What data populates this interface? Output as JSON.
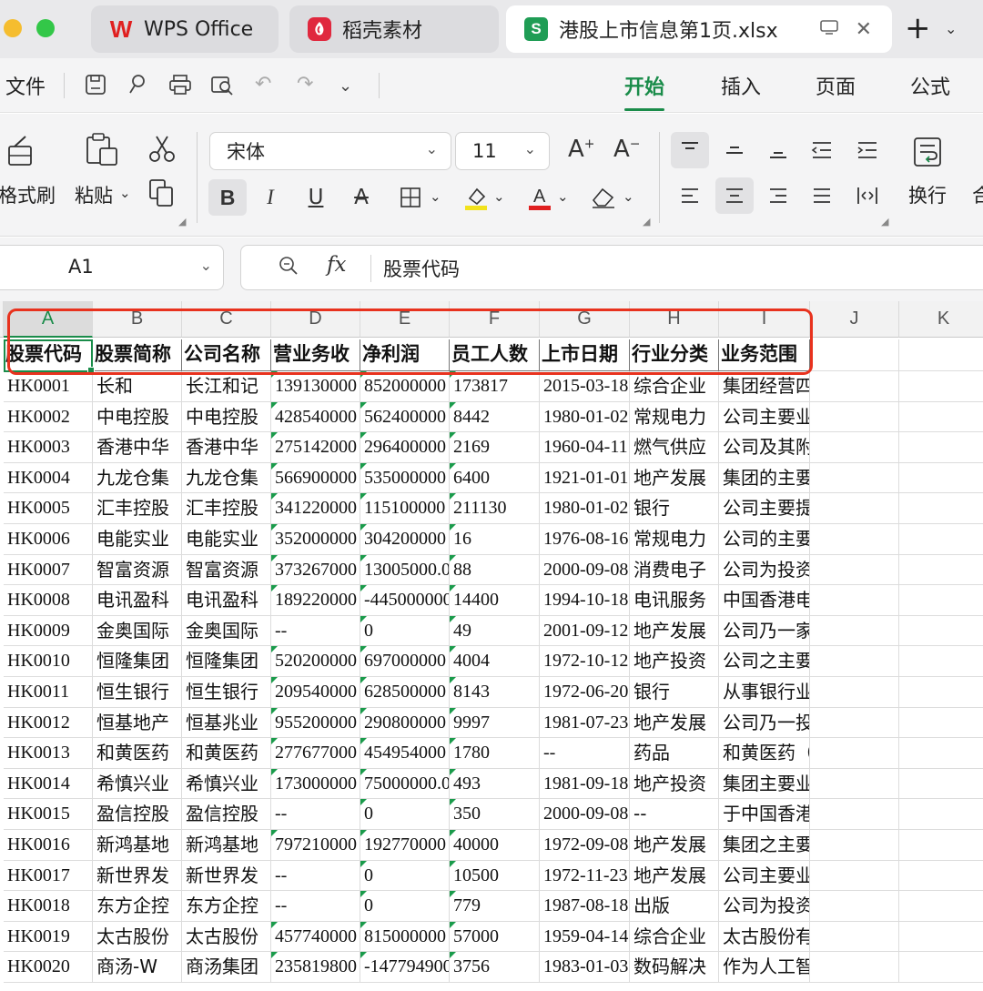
{
  "tabs": [
    {
      "label": "WPS Office",
      "icon": "wps-logo-icon"
    },
    {
      "label": "稻壳素材",
      "icon": "docer-logo-icon"
    },
    {
      "label": "港股上市信息第1页.xlsx",
      "icon": "spreadsheet-icon",
      "icon_letter": "S"
    }
  ],
  "menu": {
    "file_label": "文件",
    "ribbon_tabs": [
      "开始",
      "插入",
      "页面",
      "公式"
    ],
    "active_tab": "开始"
  },
  "ribbon": {
    "format_painter_label": "格式刷",
    "paste_label": "粘贴",
    "font_name": "宋体",
    "font_size": "11",
    "wrap_label": "换行",
    "merge_label_partial": "合"
  },
  "formula_bar": {
    "name_box": "A1",
    "fx_label": "fx",
    "value": "股票代码"
  },
  "columns": [
    "A",
    "B",
    "C",
    "D",
    "E",
    "F",
    "G",
    "H",
    "I",
    "J",
    "K"
  ],
  "selected_column": "A",
  "header_row": [
    "股票代码",
    "股票简称",
    "公司名称",
    "营业务收",
    "净利润",
    "员工人数",
    "上市日期",
    "行业分类",
    "业务范围"
  ],
  "rows": [
    [
      "HK0001",
      "长和",
      "长江和记",
      "139130000",
      "852000000",
      "173817",
      "2015-03-18",
      "综合企业",
      "集团经营四项核心业务:港口及"
    ],
    [
      "HK0002",
      "中电控股",
      "中电控股",
      "428540000",
      "562400000",
      "8442",
      "1980-01-02",
      "常规电力",
      "公司主要业务为投资控股，其"
    ],
    [
      "HK0003",
      "香港中华",
      "香港中华",
      "275142000",
      "296400000",
      "2169",
      "1960-04-11",
      "燃气供应",
      "公司及其附属公司（统称‘集"
    ],
    [
      "HK0004",
      "九龙仓集",
      "九龙仓集",
      "566900000",
      "535000000",
      "6400",
      "1921-01-01",
      "地产发展",
      "集团的主要业务为中国香港及"
    ],
    [
      "HK0005",
      "汇丰控股",
      "汇丰控股",
      "341220000",
      "115100000",
      "211130",
      "1980-01-02",
      "银行",
      "公司主要提供零售银行及财富"
    ],
    [
      "HK0006",
      "电能实业",
      "电能实业",
      "352000000",
      "304200000",
      "16",
      "1976-08-16",
      "常规电力",
      "公司的主要业务为投资控股。"
    ],
    [
      "HK0007",
      "智富资源",
      "智富资源",
      "373267000",
      "13005000.0",
      "88",
      "2000-09-08",
      "消费电子",
      "公司为投资控股公司。公司及"
    ],
    [
      "HK0008",
      "电讯盈科",
      "电讯盈科",
      "189220000",
      "-445000000",
      "14400",
      "1994-10-18",
      "电讯服务",
      "中国香港电讯及其附属公司的"
    ],
    [
      "HK0009",
      "金奥国际",
      "金奥国际",
      "--",
      "0",
      "49",
      "2001-09-12",
      "地产发展",
      "公司乃一家投资控股公司。公"
    ],
    [
      "HK0010",
      "恒隆集团",
      "恒隆集团",
      "520200000",
      "697000000",
      "4004",
      "1972-10-12",
      "地产投资",
      "公司之主要业务为控股投资，"
    ],
    [
      "HK0011",
      "恒生银行",
      "恒生银行",
      "209540000",
      "628500000",
      "8143",
      "1972-06-20",
      "银行",
      "从事银行业及有关之金融服务"
    ],
    [
      "HK0012",
      "恒基地产",
      "恒基兆业",
      "955200000",
      "290800000",
      "9997",
      "1981-07-23",
      "地产发展",
      "公司乃一投资控股公司，其附"
    ],
    [
      "HK0013",
      "和黄医药",
      "和黄医药",
      "277677000",
      "454954000",
      "1780",
      "--",
      "药品",
      "和黄医药（中国）有限公司"
    ],
    [
      "HK0014",
      "希慎兴业",
      "希慎兴业",
      "173000000",
      "75000000.0",
      "493",
      "1981-09-18",
      "地产投资",
      "集团主要业务为物业投资，管"
    ],
    [
      "HK0015",
      "盈信控股",
      "盈信控股",
      "--",
      "0",
      "350",
      "2000-09-08",
      "--",
      "于中国香港经营合约工程业务"
    ],
    [
      "HK0016",
      "新鸿基地",
      "新鸿基地",
      "797210000",
      "192770000",
      "40000",
      "1972-09-08",
      "地产发展",
      "集团之主要业务为发展及投资"
    ],
    [
      "HK0017",
      "新世界发",
      "新世界发",
      "--",
      "0",
      "10500",
      "1972-11-23",
      "地产发展",
      "公司主要业务继续为控股投资"
    ],
    [
      "HK0018",
      "东方企控",
      "东方企控",
      "--",
      "0",
      "779",
      "1987-08-18",
      "出版",
      "公司为投资控股公司及提供公"
    ],
    [
      "HK0019",
      "太古股份",
      "太古股份",
      "457740000",
      "815000000",
      "57000",
      "1959-04-14",
      "综合企业",
      "太古股份有限公司（‘公司’）"
    ],
    [
      "HK0020",
      "商汤-W",
      "商汤集团",
      "235819800",
      "-147794900",
      "3756",
      "1983-01-03",
      "数码解决",
      "作为人工智能软件公司，集团"
    ]
  ],
  "colors": {
    "accent_green": "#1a8c4a",
    "highlight_red": "#e8321e",
    "number_triangle": "#1a9b4b"
  }
}
